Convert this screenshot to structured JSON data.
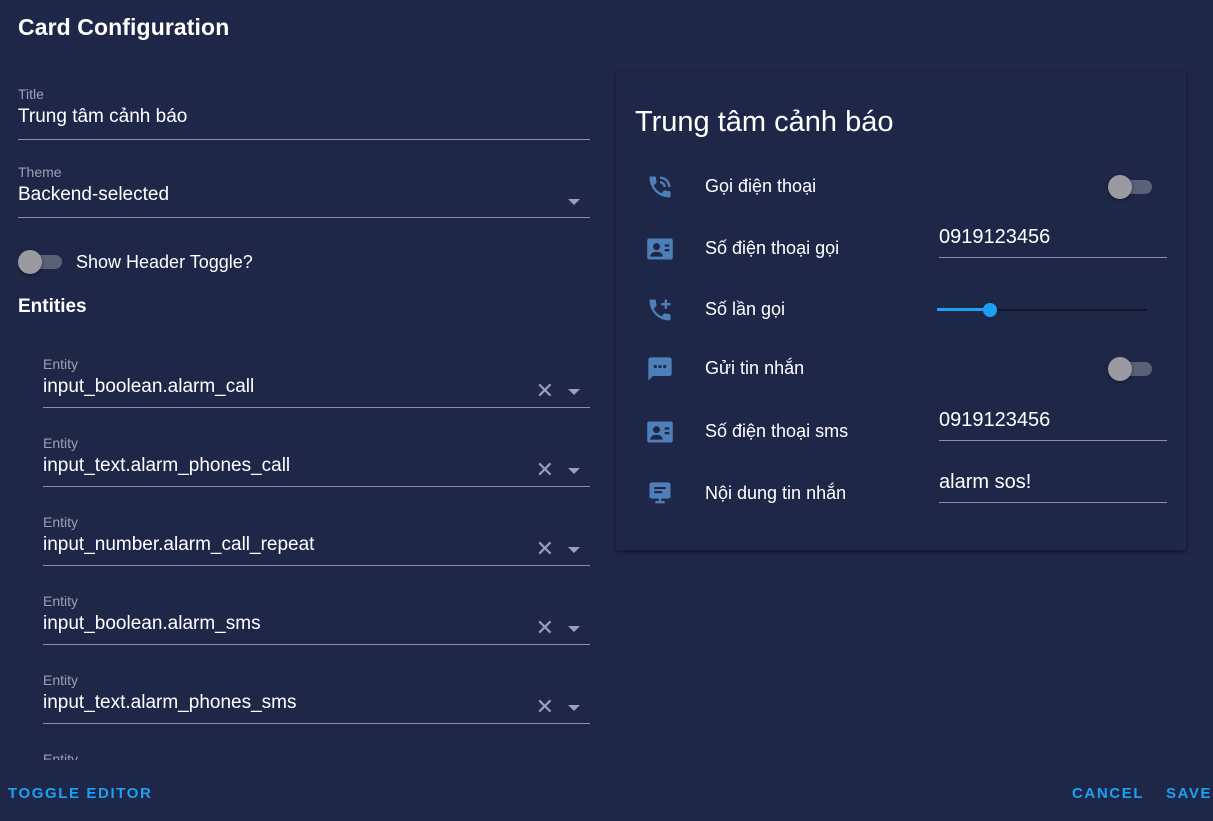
{
  "dialog": {
    "title": "Card Configuration"
  },
  "editor": {
    "title_field": {
      "label": "Title",
      "value": "Trung tâm cảnh báo"
    },
    "theme_field": {
      "label": "Theme",
      "value": "Backend-selected"
    },
    "header_toggle": {
      "label": "Show Header Toggle?",
      "on": false
    },
    "entities_heading": "Entities",
    "entities": [
      {
        "label": "Entity",
        "value": "input_boolean.alarm_call"
      },
      {
        "label": "Entity",
        "value": "input_text.alarm_phones_call"
      },
      {
        "label": "Entity",
        "value": "input_number.alarm_call_repeat"
      },
      {
        "label": "Entity",
        "value": "input_boolean.alarm_sms"
      },
      {
        "label": "Entity",
        "value": "input_text.alarm_phones_sms"
      },
      {
        "label": "Entity",
        "value": ""
      }
    ]
  },
  "preview": {
    "card_title": "Trung tâm cảnh báo",
    "rows": [
      {
        "icon": "phone-in-talk-icon",
        "name": "Gọi điện thoại",
        "control": "toggle",
        "on": false
      },
      {
        "icon": "contact-card-icon",
        "name": "Số điện thoại gọi",
        "control": "text",
        "value": "0919123456"
      },
      {
        "icon": "phone-plus-icon",
        "name": "Số lần gọi",
        "control": "slider",
        "level": 0.25
      },
      {
        "icon": "message-dots-icon",
        "name": "Gửi tin nhắn",
        "control": "toggle",
        "on": false
      },
      {
        "icon": "contact-card-icon",
        "name": "Số điện thoại sms",
        "control": "text",
        "value": "0919123456"
      },
      {
        "icon": "message-presentation-icon",
        "name": "Nội dung tin nhắn",
        "control": "text",
        "value": "alarm sos!"
      }
    ]
  },
  "actions": {
    "toggle_editor": "TOGGLE EDITOR",
    "cancel": "CANCEL",
    "save": "SAVE"
  },
  "colors": {
    "background": "#1f2749",
    "accent": "#1ea0f2",
    "icon": "#4f7fb8",
    "toggle_off": "#9a9aa2"
  }
}
